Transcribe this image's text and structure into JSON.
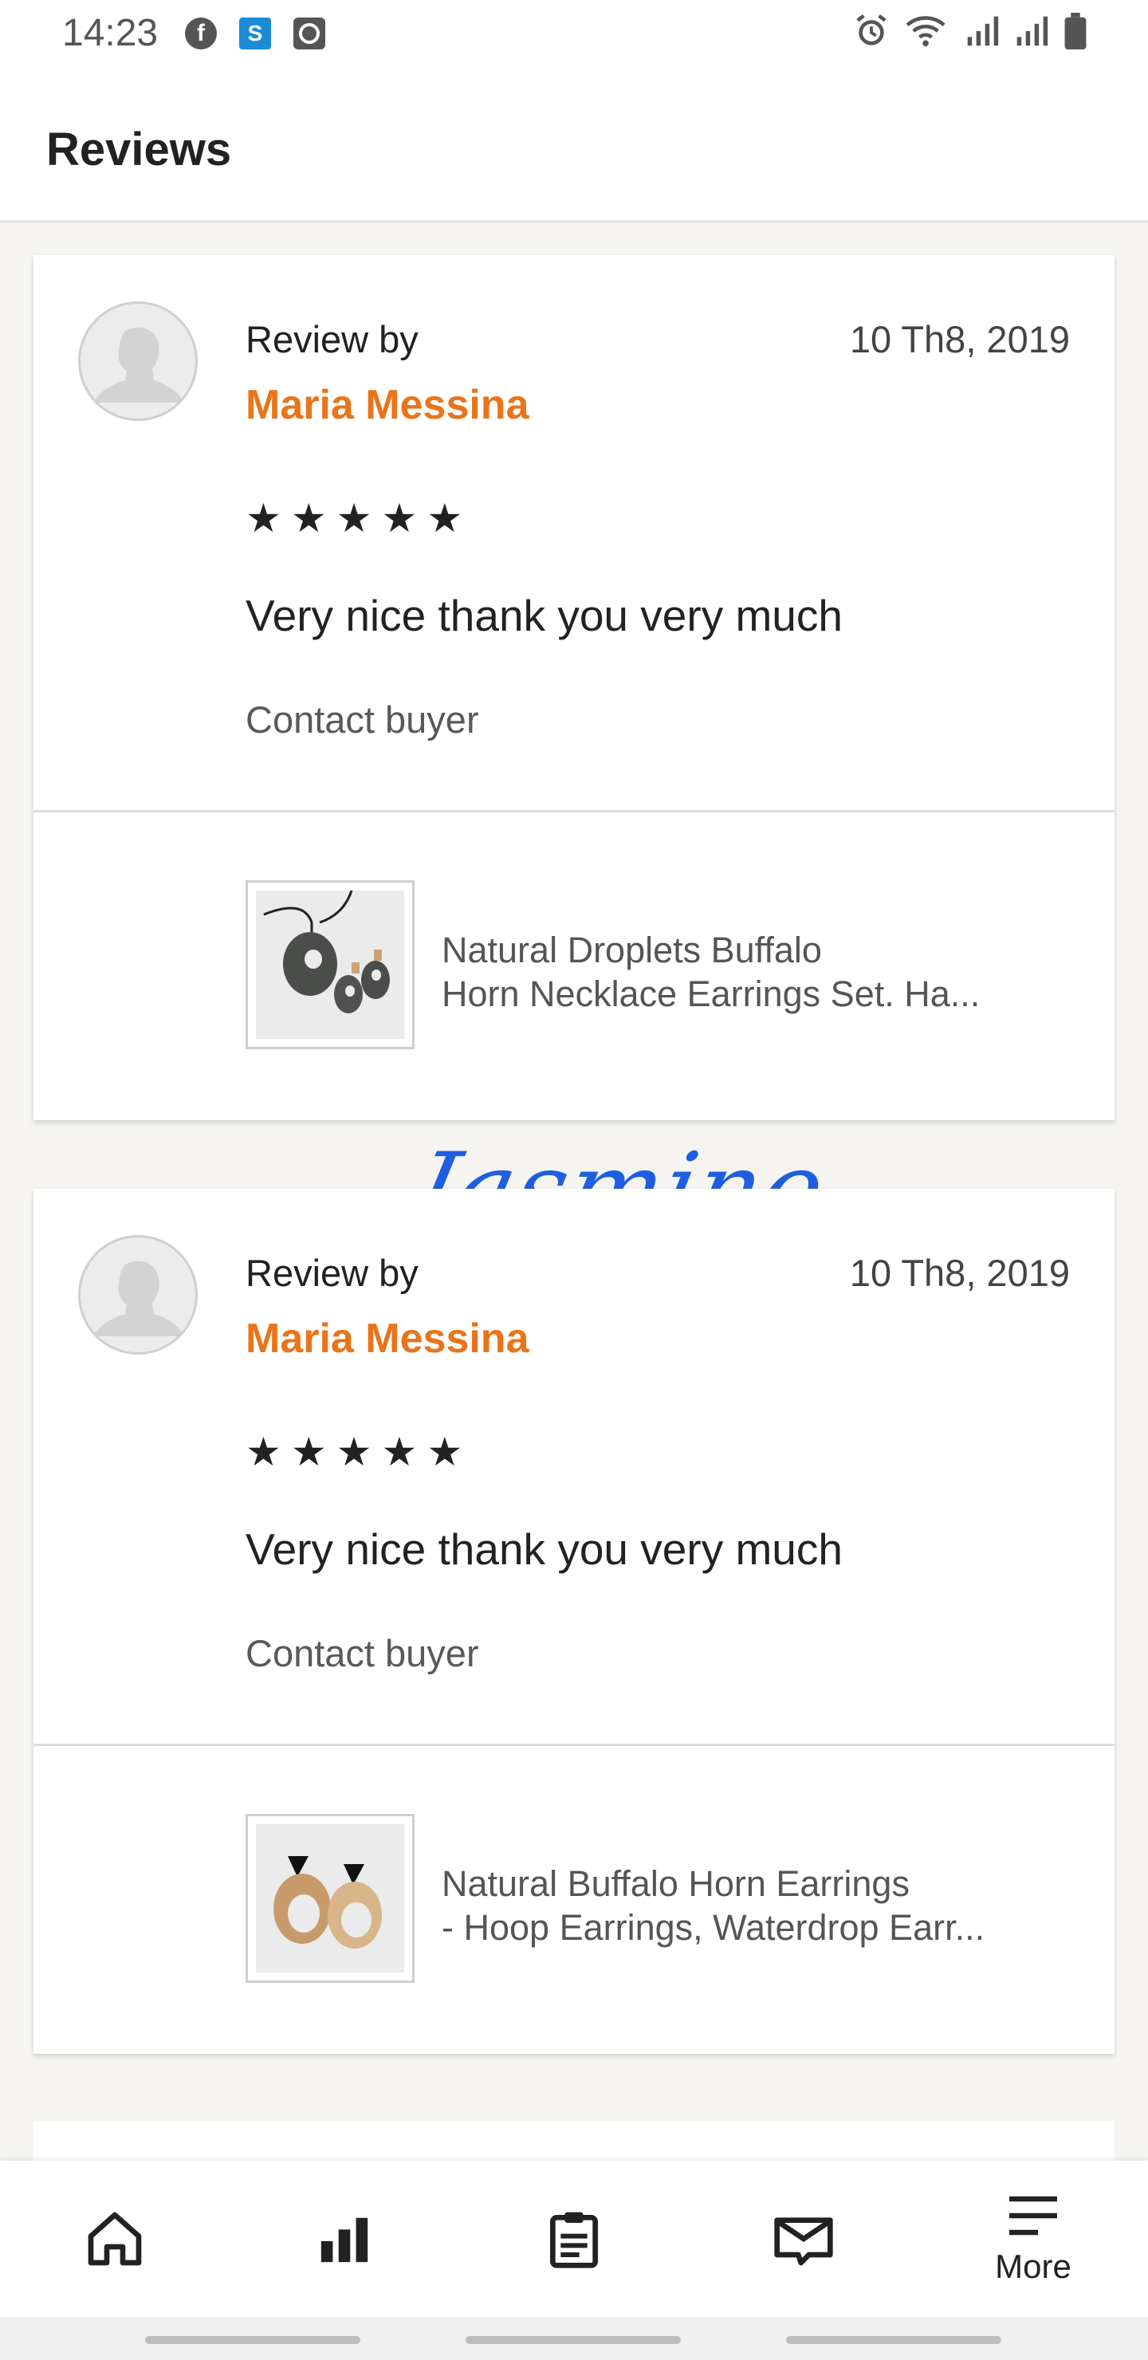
{
  "status_bar": {
    "time": "14:23",
    "left_icons": [
      "facebook-icon",
      "skype-icon",
      "clock-app-icon"
    ],
    "right_icons": [
      "alarm-icon",
      "wifi-icon",
      "signal-icon",
      "signal-icon",
      "battery-icon"
    ]
  },
  "header": {
    "title": "Reviews"
  },
  "reviews": [
    {
      "review_by_label": "Review by",
      "reviewer": "Maria Messina",
      "date": "10 Th8, 2019",
      "rating": 5,
      "stars": [
        "★",
        "★",
        "★",
        "★",
        "★"
      ],
      "text": "Very nice thank you very much",
      "contact_label": "Contact buyer",
      "listing": {
        "title_line1": "Natural Droplets Buffalo",
        "title_line2": "Horn Necklace Earrings Set. Ha..."
      }
    },
    {
      "review_by_label": "Review by",
      "reviewer": "Maria Messina",
      "date": "10 Th8, 2019",
      "rating": 5,
      "stars": [
        "★",
        "★",
        "★",
        "★",
        "★"
      ],
      "text": "Very nice thank you very much",
      "contact_label": "Contact buyer",
      "listing": {
        "title_line1": "Natural Buffalo Horn Earrings",
        "title_line2": "- Hoop Earrings, Waterdrop Earr..."
      }
    }
  ],
  "watermark": "Jasmino",
  "bottom_nav": {
    "items": [
      {
        "icon": "home-icon",
        "label": ""
      },
      {
        "icon": "stats-icon",
        "label": ""
      },
      {
        "icon": "orders-clipboard-icon",
        "label": ""
      },
      {
        "icon": "messages-icon",
        "label": ""
      },
      {
        "icon": "menu-icon",
        "label": "More"
      }
    ]
  },
  "colors": {
    "accent": "#e9741a",
    "watermark": "#1e5ee0",
    "background": "#f5f4f0"
  }
}
